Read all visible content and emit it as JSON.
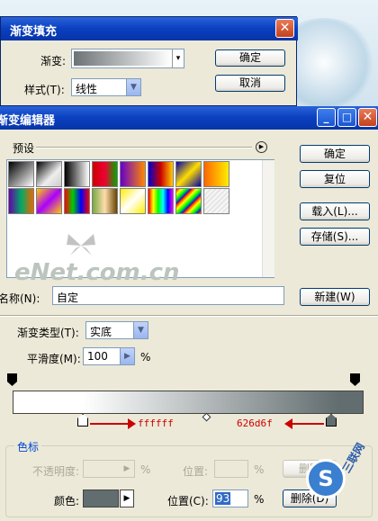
{
  "fill_dialog": {
    "title": "渐变填充",
    "gradient_label": "渐变:",
    "style_label": "样式(T):",
    "style_value": "线性",
    "ok_label": "确定",
    "cancel_label": "取消",
    "close_glyph": "✕"
  },
  "editor": {
    "title": "渐变编辑器",
    "presets_label": "预设",
    "ok_label": "确定",
    "reset_label": "复位",
    "load_label": "载入(L)...",
    "save_label": "存储(S)...",
    "name_label": "名称(N):",
    "name_value": "自定",
    "new_label": "新建(W)",
    "type_label": "渐变类型(T):",
    "type_value": "实底",
    "smooth_label": "平滑度(M):",
    "smooth_value": "100",
    "smooth_unit": "%",
    "watermark": "eNet.com.cn",
    "stop_left_label": "ffffff",
    "stop_right_label": "626d6f",
    "color_stops_label": "色标",
    "opacity_label": "不透明度:",
    "opacity_unit": "%",
    "opacity_location_label": "位置:",
    "opacity_location_unit": "%",
    "opacity_delete_label": "删除",
    "color_label": "颜色:",
    "location_label": "位置(C):",
    "location_value": "93",
    "location_unit": "%",
    "delete_label": "删除(D)",
    "logo_text": "三联网"
  },
  "colors": {
    "stop_color": "#626d6f",
    "arrow_red": "#cc0000",
    "title_blue": "#0a3fbf"
  }
}
